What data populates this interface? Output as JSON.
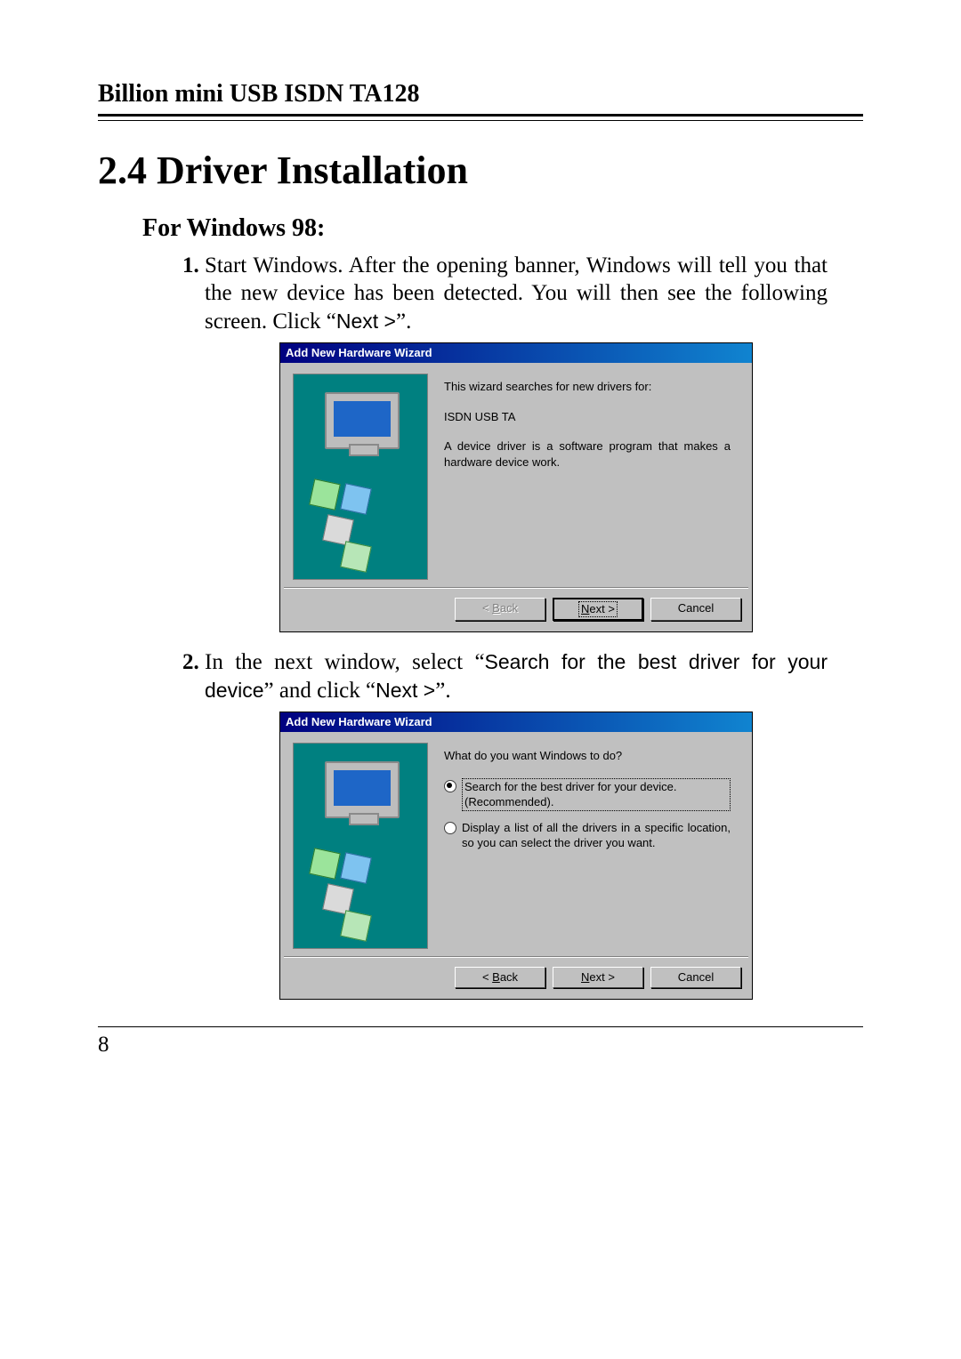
{
  "header": "Billion mini USB ISDN TA128",
  "section_title": "2.4 Driver Installation",
  "subheading": "For Windows 98:",
  "steps": {
    "s1_a": "Start Windows.  After the opening banner, Windows will tell you that the new device has been detected.  You will then see the following screen. Click “",
    "s1_btn": "Next >",
    "s1_b": "”.",
    "s2_a": "In the next window, select “",
    "s2_opt": "Search for the best driver for your device",
    "s2_b": "” and click “",
    "s2_btn": "Next >",
    "s2_c": "”."
  },
  "wizard1": {
    "title": "Add New Hardware Wizard",
    "line1": "This wizard searches for new drivers for:",
    "device": "ISDN USB TA",
    "line2": "A device driver is a software program that makes a hardware device work.",
    "back_u": "B",
    "back_rest": "ack",
    "next_u": "N",
    "next_rest": "ext >",
    "cancel": "Cancel"
  },
  "wizard2": {
    "title": "Add New Hardware Wizard",
    "prompt": "What do you want Windows to do?",
    "opt1a": "Search for the best driver for your device.",
    "opt1b": "(Recommended).",
    "opt2": "Display a list of all the drivers in a specific location, so you can select the driver you want.",
    "back_u": "B",
    "back_rest": "ack",
    "next_u": "N",
    "next_rest": "ext >",
    "cancel": "Cancel"
  },
  "page_number": "8"
}
